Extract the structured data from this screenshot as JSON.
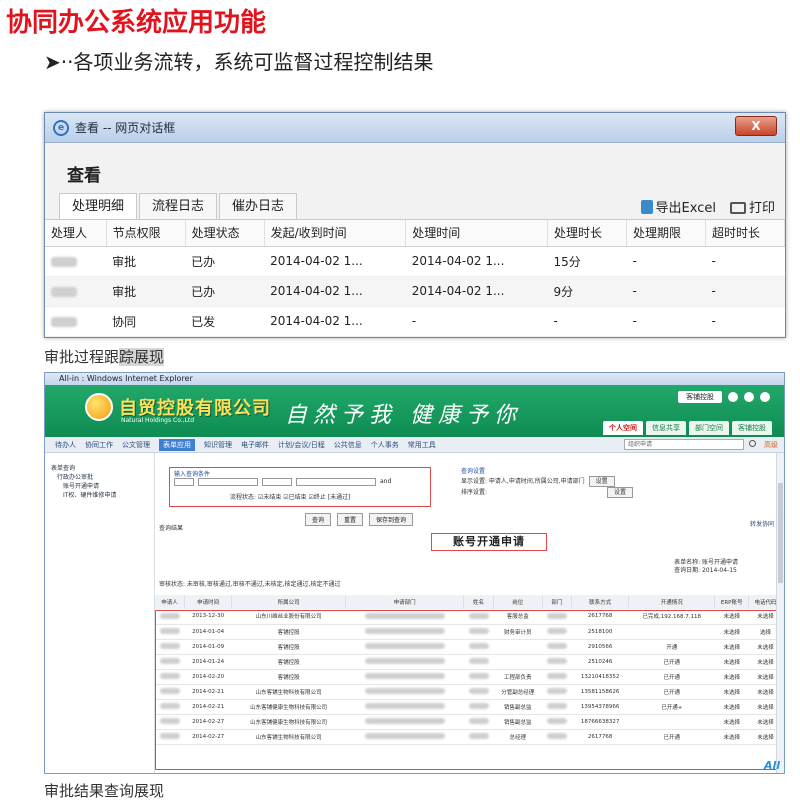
{
  "slide": {
    "title": "协同办公系统应用功能",
    "bullet": "➤··各项业务流转，系统可监督过程控制结果",
    "caption1_pre": "审批过程跟",
    "caption1_hl": "踪展现",
    "caption2": "审批结果查询展现"
  },
  "dialog": {
    "window_title": "查看 -- 网页对话框",
    "close_label": "X",
    "heading": "查看",
    "tabs": [
      "处理明细",
      "流程日志",
      "催办日志"
    ],
    "export_label": "导出Excel",
    "print_label": "打印",
    "columns": [
      "处理人",
      "节点权限",
      "处理状态",
      "发起/收到时间",
      "处理时间",
      "处理时长",
      "处理期限",
      "超时时长"
    ],
    "rows": [
      [
        "",
        "审批",
        "已办",
        "2014-04-02 1...",
        "2014-04-02 1...",
        "15分",
        "-",
        "-"
      ],
      [
        "",
        "审批",
        "已办",
        "2014-04-02 1...",
        "2014-04-02 1...",
        "9分",
        "-",
        "-"
      ],
      [
        "",
        "协同",
        "已发",
        "2014-04-02 1...",
        "-",
        "-",
        "-",
        "-"
      ]
    ]
  },
  "app": {
    "window_title": "All-in : Windows Internet Explorer",
    "company": "自贸控股有限公司",
    "company_sub": "Natural Holdings Co.,Ltd",
    "slogan": "自然予我 健康予你",
    "user_select": "客铺控股",
    "top_tabs": [
      "个人空间",
      "信息共享",
      "部门空间",
      "客铺控股"
    ],
    "nav_items": [
      "待办人",
      "协同工作",
      "公文管理",
      "表单应用",
      "知识管理",
      "电子邮件",
      "计划/会议/日程",
      "公共信息",
      "个人事务",
      "常用工具"
    ],
    "nav_active": "表单应用",
    "search_placeholder": "组织申请",
    "search_label": "高级",
    "side_items": [
      "表单查询",
      "行政办公审批",
      "账号开通申请",
      "IT权、硬件维修申请"
    ],
    "query_label": "输入查询条件",
    "query_and": "and",
    "query_status": "流程状态: ☑未结束 ☑已结束 ☑终止 [未通过]",
    "query_right": [
      "查询设置",
      "显示设置: 申请人,申请时间,所属公司,申请部门",
      "排序设置:"
    ],
    "query_right_btn": "设置",
    "buttons": [
      "查询",
      "重置",
      "保存到查询"
    ],
    "result_label": "查询结果",
    "export_label": "转发协同",
    "form_title": "账号开通申请",
    "form_meta": [
      "表单名称: 账号开通申请",
      "查询日期: 2014-04-15"
    ],
    "form_status": "审核状态: 未审核,审核通过,审核不通过,未核定,核定通过,核定不通过",
    "res_columns": [
      "申请人",
      "申请时间",
      "所属公司",
      "申请部门",
      "姓名",
      "岗位",
      "部门",
      "联系方式",
      "开通情况",
      "ERP账号",
      "电话代码"
    ],
    "res_rows": [
      [
        "",
        "2013-12-30",
        "山东川维丝业股份有限公司",
        "",
        "",
        "客服总监",
        "",
        "2617768",
        "已完成,192.168.7.118",
        "未选择",
        "未选择"
      ],
      [
        "",
        "2014-01-04",
        "客铺控股",
        "",
        "",
        "财务审计员",
        "",
        "2518100",
        "",
        "未选择",
        "选择"
      ],
      [
        "",
        "2014-01-09",
        "客铺控股",
        "",
        "",
        "",
        "",
        "2910566",
        "开通",
        "未选择",
        "未选择"
      ],
      [
        "",
        "2014-01-24",
        "客铺控股",
        "",
        "",
        "",
        "",
        "2510246",
        "已开通",
        "未选择",
        "未选择"
      ],
      [
        "",
        "2014-02-20",
        "客铺控股",
        "",
        "",
        "工程部负责",
        "",
        "13210418352",
        "已开通",
        "未选择",
        "未选择"
      ],
      [
        "",
        "2014-02-21",
        "山东客铺生物科技有限公司",
        "",
        "",
        "分管副总经理",
        "",
        "13581158626",
        "已开通",
        "未选择",
        "未选择"
      ],
      [
        "",
        "2014-02-21",
        "山东客铺健康生物科技有限公司",
        "",
        "",
        "销售副总监",
        "",
        "13954378966",
        "已开通+",
        "未选择",
        "未选择"
      ],
      [
        "",
        "2014-02-27",
        "山东客铺健康生物科技有限公司",
        "",
        "",
        "销售副总监",
        "",
        "18766638327",
        "",
        "未选择",
        "未选择"
      ],
      [
        "",
        "2014-02-27",
        "山东客铺生物科技有限公司",
        "",
        "",
        "总经理",
        "",
        "2617768",
        "已开通",
        "未选择",
        "未选择"
      ]
    ],
    "watermark": "All"
  }
}
